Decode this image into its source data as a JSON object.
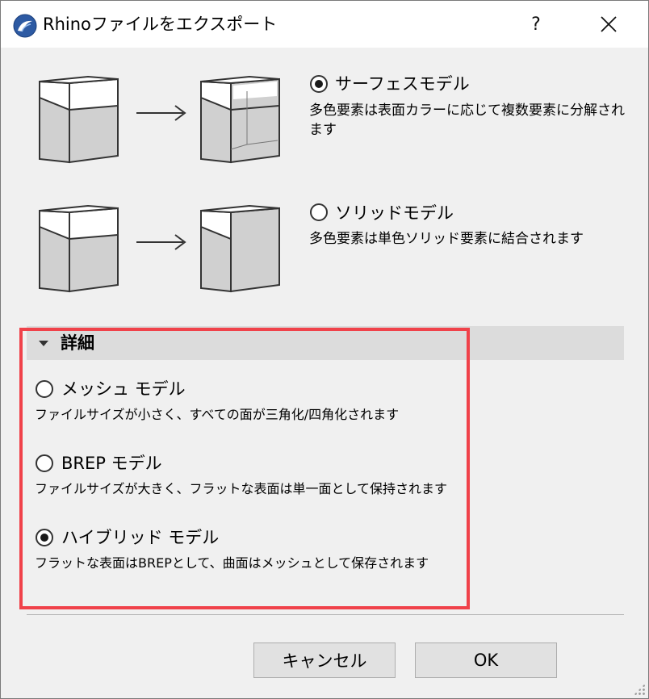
{
  "window": {
    "title": "Rhinoファイルをエクスポート",
    "help_glyph": "?",
    "close_glyph": "✕",
    "icon": "rhino-app-icon"
  },
  "export_mode": {
    "surface": {
      "label": "サーフェスモデル",
      "description": "多色要素は表面カラーに応じて複数要素に分解されます",
      "selected": true
    },
    "solid": {
      "label": "ソリッドモデル",
      "description": "多色要素は単色ソリッド要素に結合されます",
      "selected": false
    }
  },
  "details": {
    "title": "詳細",
    "expanded": true,
    "options": [
      {
        "label": "メッシュ モデル",
        "description": "ファイルサイズが小さく、すべての面が三角化/四角化されます",
        "selected": false
      },
      {
        "label": "BREP モデル",
        "description": "ファイルサイズが大きく、フラットな表面は単一面として保持されます",
        "selected": false
      },
      {
        "label": "ハイブリッド モデル",
        "description": "フラットな表面はBREPとして、曲面はメッシュとして保存されます",
        "selected": true
      }
    ]
  },
  "buttons": {
    "cancel": "キャンセル",
    "ok": "OK"
  },
  "colors": {
    "highlight": "#f0424a",
    "panel": "#f0f0f0",
    "header": "#dcdcdc"
  }
}
